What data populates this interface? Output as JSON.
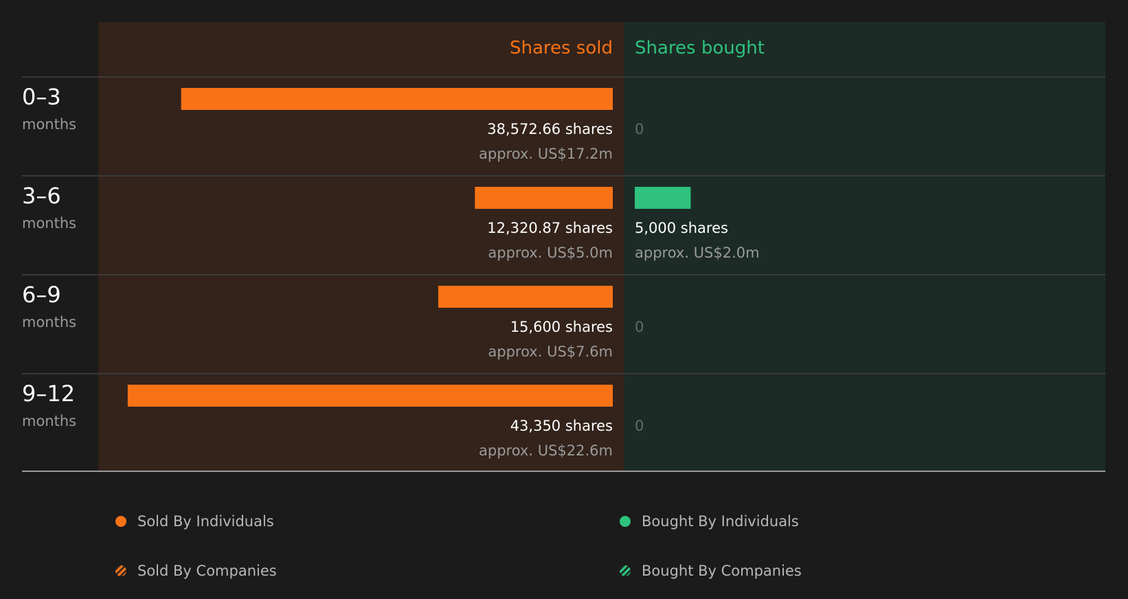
{
  "chart_data": {
    "type": "bar",
    "orientation": "diverging-horizontal",
    "headers": {
      "sold": "Shares sold",
      "bought": "Shares bought"
    },
    "colors": {
      "sold": "#f97316",
      "bought": "#2ec27e",
      "sold_bg": "#33231b",
      "bought_bg": "#1c2b25"
    },
    "x_max": 45000,
    "rows": [
      {
        "period": "0–3",
        "unit": "months",
        "sold": 38572.66,
        "sold_label": "38,572.66 shares",
        "sold_value": "approx. US$17.2m",
        "bought": 0,
        "bought_label": "0",
        "bought_value": ""
      },
      {
        "period": "3–6",
        "unit": "months",
        "sold": 12320.87,
        "sold_label": "12,320.87 shares",
        "sold_value": "approx. US$5.0m",
        "bought": 5000,
        "bought_label": "5,000 shares",
        "bought_value": "approx. US$2.0m"
      },
      {
        "period": "6–9",
        "unit": "months",
        "sold": 15600,
        "sold_label": "15,600 shares",
        "sold_value": "approx. US$7.6m",
        "bought": 0,
        "bought_label": "0",
        "bought_value": ""
      },
      {
        "period": "9–12",
        "unit": "months",
        "sold": 43350,
        "sold_label": "43,350 shares",
        "sold_value": "approx. US$22.6m",
        "bought": 0,
        "bought_label": "0",
        "bought_value": ""
      }
    ]
  },
  "legend": [
    {
      "label": "Sold By Individuals",
      "style": "solid",
      "color": "#f97316"
    },
    {
      "label": "Bought By Individuals",
      "style": "solid",
      "color": "#2ec27e"
    },
    {
      "label": "Sold By Companies",
      "style": "hatched",
      "color": "#f97316"
    },
    {
      "label": "Bought By Companies",
      "style": "hatched",
      "color": "#2ec27e"
    }
  ]
}
